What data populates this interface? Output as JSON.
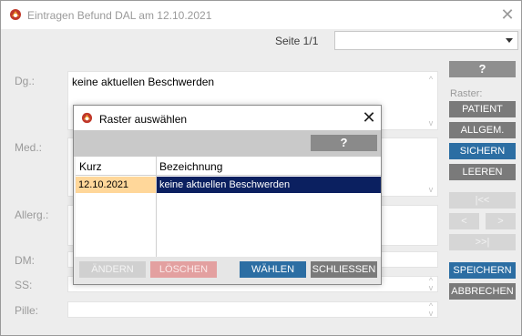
{
  "window": {
    "title": "Eintragen Befund DAL am 12.10.2021",
    "page_label": "Seite 1/1",
    "page_select_value": ""
  },
  "fields": [
    {
      "label": "Dg.:",
      "value": "keine aktuellen Beschwerden"
    },
    {
      "label": "Med.:",
      "value": ""
    },
    {
      "label": "Allerg.:",
      "value": ""
    },
    {
      "label": "DM:",
      "value": ""
    },
    {
      "label": "SS:",
      "value": ""
    },
    {
      "label": "Pille:",
      "value": ""
    }
  ],
  "sidebar": {
    "help_label": "?",
    "raster_label": "Raster:",
    "patient_label": "PATIENT",
    "allgem_label": "ALLGEM.",
    "sichern_label": "SICHERN",
    "leeren_label": "LEEREN",
    "first_label": "|<<",
    "prev_label": "<",
    "next_label": ">",
    "last_label": ">>|",
    "speichern_label": "SPEICHERN",
    "abbrechen_label": "ABBRECHEN"
  },
  "dialog": {
    "title": "Raster auswählen",
    "help_label": "?",
    "columns": [
      "Kurz",
      "Bezeichnung"
    ],
    "rows": [
      {
        "kurz": "12.10.2021",
        "bezeichnung": "keine aktuellen Beschwerden"
      }
    ],
    "buttons": {
      "aendern": "ÄNDERN",
      "loeschen": "LÖSCHEN",
      "waehlen": "WÄHLEN",
      "schliessen": "SCHLIESSEN"
    }
  },
  "icons": {
    "window_icon": "app-logo-icon",
    "close": "close-icon",
    "dropdown": "chevron-down-icon"
  },
  "colors": {
    "accent_blue": "#2c6ea3",
    "selected_row": "#0b2060",
    "highlight_cell": "#ffd79a",
    "delete_disabled": "#e3a0a0"
  }
}
